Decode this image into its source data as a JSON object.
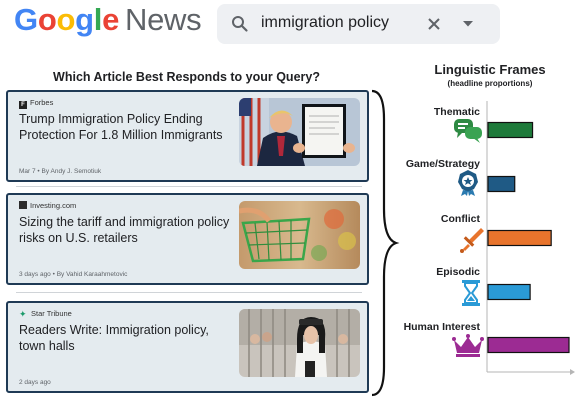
{
  "header": {
    "logo_google": "Google",
    "logo_news": "News",
    "search_query": "immigration policy",
    "icons": [
      "search-icon",
      "close-icon",
      "dropdown-caret-icon"
    ]
  },
  "left_panel": {
    "title": "Which Article Best Responds to your Query?",
    "articles": [
      {
        "source": "Forbes",
        "title": "Trump Immigration Policy Ending Protection For 1.8 Million Immigrants",
        "meta": "Mar 7 • By Andy J. Semotiuk"
      },
      {
        "source": "Investing.com",
        "title": "Sizing the tariff and immigration policy risks on U.S. retailers",
        "meta": "3 days ago • By Vahid Karaahmetovic"
      },
      {
        "source": "Star Tribune",
        "title": "Readers Write: Immigration policy, town halls",
        "meta": "2 days ago"
      }
    ]
  },
  "right_panel": {
    "title": "Linguistic Frames",
    "subtitle": "(headline proportions)",
    "frames": [
      {
        "label": "Thematic",
        "icon": "speech-bubbles-icon",
        "color": "#1e7a3a"
      },
      {
        "label": "Game/Strategy",
        "icon": "medal-icon",
        "color": "#1f5a85"
      },
      {
        "label": "Conflict",
        "icon": "sword-icon",
        "color": "#e8742c"
      },
      {
        "label": "Episodic",
        "icon": "hourglass-icon",
        "color": "#2a9ad6"
      },
      {
        "label": "Human Interest",
        "icon": "crown-icon",
        "color": "#9c2b93"
      }
    ]
  },
  "chart_data": {
    "type": "bar",
    "orientation": "horizontal",
    "categories": [
      "Thematic",
      "Game/Strategy",
      "Conflict",
      "Episodic",
      "Human Interest"
    ],
    "values": [
      0.55,
      0.33,
      0.78,
      0.52,
      1.0
    ],
    "colors": [
      "#1e7a3a",
      "#1f5a85",
      "#e8742c",
      "#2a9ad6",
      "#9c2b93"
    ],
    "title": "Linguistic Frames",
    "subtitle": "(headline proportions)",
    "xlim": [
      0,
      1
    ]
  }
}
